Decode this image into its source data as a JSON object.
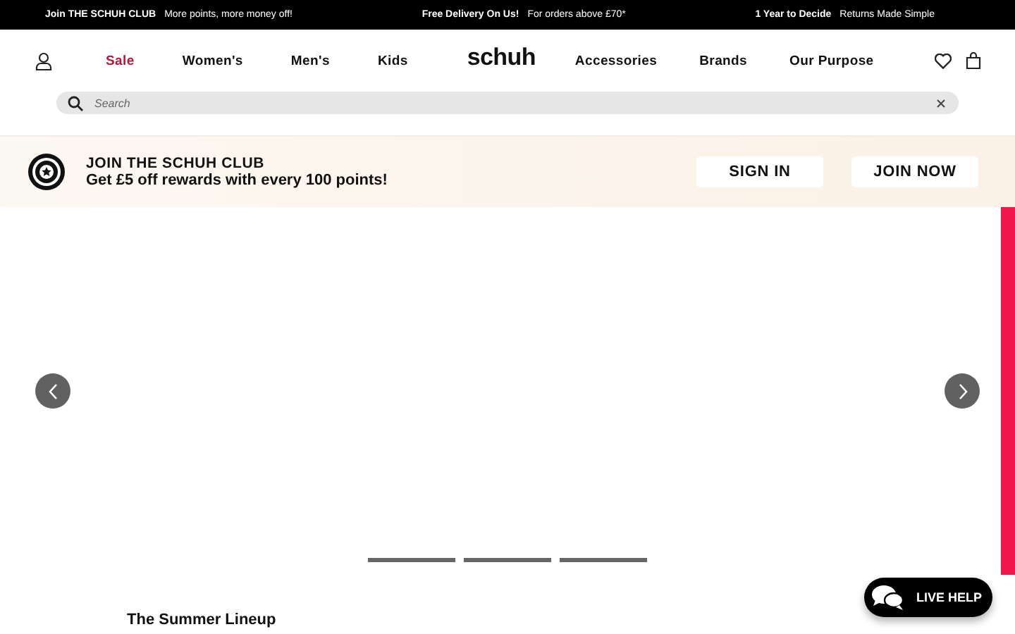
{
  "promo_bar": [
    {
      "title": "Join THE SCHUH CLUB",
      "text": "More points, more money off!"
    },
    {
      "title": "Free Delivery On Us!",
      "text": "For orders above £70*"
    },
    {
      "title": "1 Year to Decide",
      "text": "Returns Made Simple"
    }
  ],
  "nav": {
    "left": [
      {
        "label": "Sale",
        "kind": "sale"
      },
      {
        "label": "Women's",
        "kind": "normal"
      },
      {
        "label": "Men's",
        "kind": "normal"
      },
      {
        "label": "Kids",
        "kind": "normal"
      }
    ],
    "logo": "schuh",
    "right": [
      {
        "label": "Accessories"
      },
      {
        "label": "Brands"
      },
      {
        "label": "Our Purpose"
      }
    ]
  },
  "search": {
    "placeholder": "Search"
  },
  "club_banner": {
    "title": "JOIN THE SCHUH CLUB",
    "text": "Get £5 off rewards with every 100 points!",
    "buttons": [
      "SIGN IN",
      "JOIN NOW"
    ]
  },
  "section_title": "The Summer Lineup",
  "live_help": "LIVE HELP"
}
